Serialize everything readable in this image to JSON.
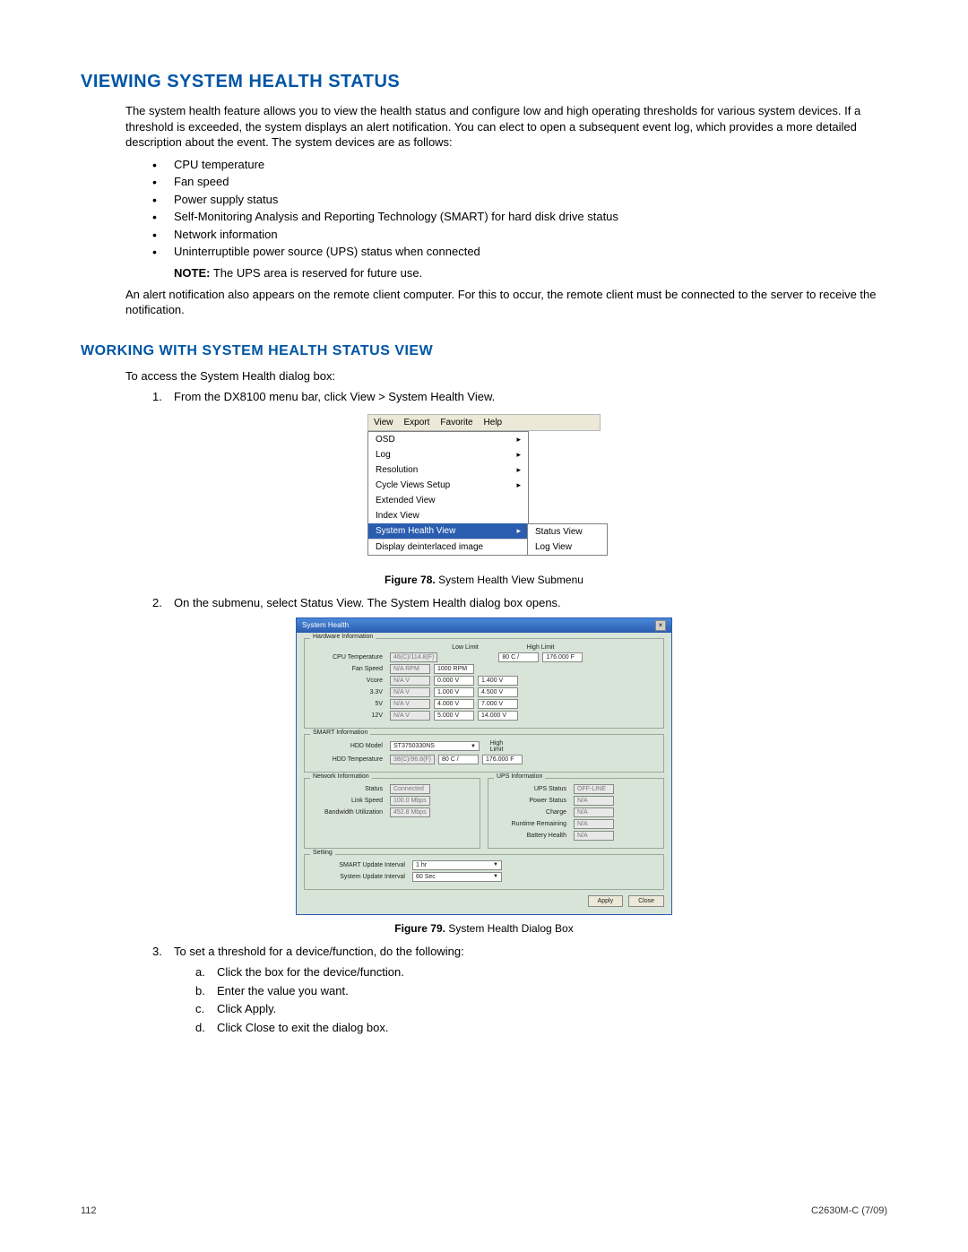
{
  "heading1": "VIEWING SYSTEM HEALTH STATUS",
  "intro_para": "The system health feature allows you to view the health status and configure low and high operating thresholds for various system devices. If a threshold is exceeded, the system displays an alert notification. You can elect to open a subsequent event log, which provides a more detailed description about the event. The system devices are as follows:",
  "bullets": [
    "CPU temperature",
    "Fan speed",
    "Power supply status",
    "Self-Monitoring Analysis and Reporting Technology (SMART) for hard disk drive status",
    "Network information",
    "Uninterruptible power source (UPS) status when connected"
  ],
  "note_label": "NOTE:",
  "note_text": "The UPS area is reserved for future use.",
  "para2": "An alert notification also appears on the remote client computer. For this to occur, the remote client must be connected to the server to receive the notification.",
  "heading2": "WORKING WITH SYSTEM HEALTH STATUS VIEW",
  "access_line": "To access the System Health dialog box:",
  "step1": "From the DX8100 menu bar, click View > System Health View.",
  "step2": "On the submenu, select Status View. The System Health dialog box opens.",
  "step3": "To set a threshold for a device/function, do the following:",
  "sub_steps": [
    "Click the box for the device/function.",
    "Enter the value you want.",
    "Click Apply.",
    "Click Close to exit the dialog box."
  ],
  "fig78_label": "Figure 78.",
  "fig78_caption": "System Health View Submenu",
  "fig79_label": "Figure 79.",
  "fig79_caption": "System Health Dialog Box",
  "menu": {
    "bar": [
      "View",
      "Export",
      "Favorite",
      "Help"
    ],
    "items": [
      "OSD",
      "Log",
      "Resolution",
      "Cycle Views Setup",
      "Extended View",
      "Index View",
      "System Health View",
      "Display deinterlaced image"
    ],
    "submenu": [
      "Status View",
      "Log View"
    ]
  },
  "dialog": {
    "title": "System Health",
    "hw_legend": "Hardware Information",
    "low_limit": "Low Limit",
    "high_limit": "High Limit",
    "cpu_temp_lbl": "CPU Temperature",
    "cpu_temp_val": "46(C)/114.8(F)",
    "cpu_high_c": "80 C /",
    "cpu_high_f": "176.000 F",
    "fan_lbl": "Fan Speed",
    "fan_rows": [
      {
        "name": "",
        "cur": "N/A RPM",
        "low": "1000 RPM"
      },
      {
        "name": "Vcore",
        "cur": "N/A V",
        "low": "0.000 V",
        "high": "1.400 V"
      },
      {
        "name": "3.3V",
        "cur": "N/A V",
        "low": "1.000 V",
        "high": "4.500 V"
      },
      {
        "name": "5V",
        "cur": "N/A V",
        "low": "4.000 V",
        "high": "7.000 V"
      },
      {
        "name": "12V",
        "cur": "N/A V",
        "low": "5.000 V",
        "high": "14.000 V"
      }
    ],
    "smart_legend": "SMART Information",
    "hdd_model_lbl": "HDD Model",
    "hdd_model_val": "ST3750330NS",
    "hdd_temp_lbl": "HDD Temperature",
    "hdd_temp_val": "38(C)/96.8(F)",
    "hdd_high_c": "80 C /",
    "hdd_high_f": "176.000 F",
    "net_legend": "Network Information",
    "net_status_lbl": "Status",
    "net_status_val": "Connected",
    "net_link_lbl": "Link Speed",
    "net_link_val": "100.0 Mbps",
    "net_bw_lbl": "Bandwidth Utilization",
    "net_bw_val": "452.8 Mbps",
    "ups_legend": "UPS Information",
    "ups_status_lbl": "UPS Status",
    "ups_status_val": "OFF-LINE",
    "ups_power_lbl": "Power Status",
    "ups_power_val": "N/A",
    "ups_charge_lbl": "Charge",
    "ups_charge_val": "N/A",
    "ups_runtime_lbl": "Runtime Remaining",
    "ups_runtime_val": "N/A",
    "ups_batt_lbl": "Battery Health",
    "ups_batt_val": "N/A",
    "setting_legend": "Setting",
    "smart_int_lbl": "SMART Update Interval",
    "smart_int_val": "1 hr",
    "sys_int_lbl": "System Update Interval",
    "sys_int_val": "60 Sec",
    "apply_btn": "Apply",
    "close_btn": "Close"
  },
  "footer_left": "112",
  "footer_right": "C2630M-C (7/09)"
}
